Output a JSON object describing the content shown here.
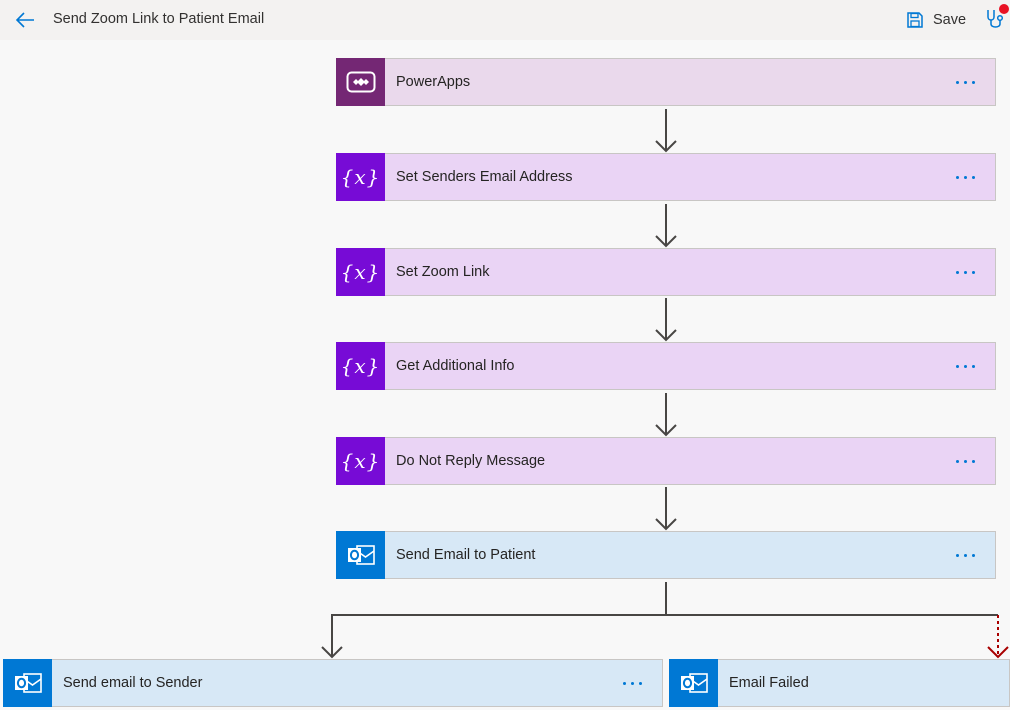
{
  "header": {
    "title": "Send Zoom Link to Patient Email",
    "save_label": "Save",
    "back_icon": "arrow-left-icon",
    "save_icon": "save-disk-icon",
    "checker_icon": "stethoscope-icon",
    "checker_badge_color": "#e81123"
  },
  "steps": [
    {
      "title": "PowerApps",
      "icon": "powerapps-icon",
      "color": "#742774"
    },
    {
      "title": "Set Senders Email Address",
      "icon": "variable-icon",
      "color": "#770bd6"
    },
    {
      "title": "Set Zoom Link",
      "icon": "variable-icon",
      "color": "#770bd6"
    },
    {
      "title": "Get Additional Info",
      "icon": "variable-icon",
      "color": "#770bd6"
    },
    {
      "title": "Do Not Reply Message",
      "icon": "variable-icon",
      "color": "#770bd6"
    },
    {
      "title": "Send Email to Patient",
      "icon": "outlook-icon",
      "color": "#0078d4"
    }
  ],
  "branches": [
    {
      "title": "Send email to Sender",
      "icon": "outlook-icon",
      "run_after": "success"
    },
    {
      "title": "Email Failed",
      "icon": "outlook-icon",
      "run_after": "failed"
    }
  ],
  "colors": {
    "accent": "#0078d4",
    "failure_arrow": "#a80000"
  }
}
